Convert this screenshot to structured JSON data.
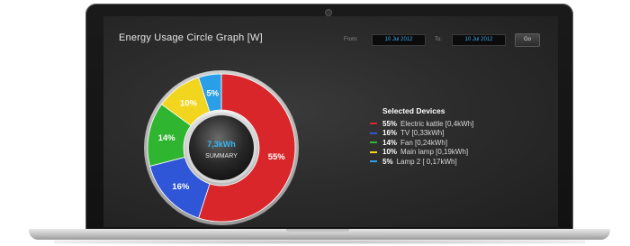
{
  "app": {
    "title": "Energy Usage Circle Graph [W]",
    "from_label": "From:",
    "from_date": "10 Jul 2012",
    "to_label": "To:",
    "to_date": "10 Jul 2012",
    "go_label": "Go"
  },
  "summary": {
    "value": "7,3kWh",
    "label": "SUMMARY"
  },
  "legend": {
    "title": "Selected Devices",
    "items": [
      {
        "pct": "55%",
        "name": "Electric kattle [0,4kWh]",
        "color": "#d9262b"
      },
      {
        "pct": "16%",
        "name": "TV [0,33kWh]",
        "color": "#2f56d6"
      },
      {
        "pct": "14%",
        "name": "Fan [0,24kWh]",
        "color": "#2fb52f"
      },
      {
        "pct": "10%",
        "name": "Main lamp [0,19kWh]",
        "color": "#f2d51e"
      },
      {
        "pct": "5%",
        "name": "Lamp 2 [ 0,17kWh]",
        "color": "#2a9fe8"
      }
    ]
  },
  "chart_data": {
    "type": "pie",
    "categories": [
      "Electric kattle",
      "TV",
      "Fan",
      "Main lamp",
      "Lamp 2"
    ],
    "values": [
      55,
      16,
      14,
      10,
      5
    ],
    "labels": [
      "55%",
      "16%",
      "14%",
      "10%",
      "5%"
    ],
    "colors": [
      "#d9262b",
      "#2f56d6",
      "#2fb52f",
      "#f2d51e",
      "#2a9fe8"
    ],
    "title": "Energy Usage Circle Graph [W]",
    "center_text": "7,3kWh",
    "center_subtext": "SUMMARY",
    "style": "donut"
  }
}
